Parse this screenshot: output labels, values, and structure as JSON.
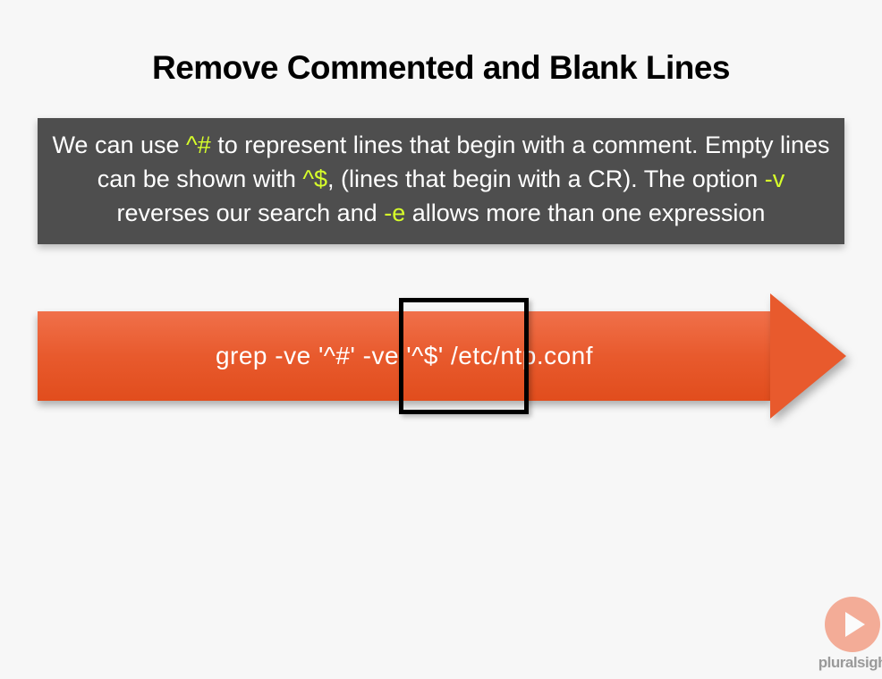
{
  "title": "Remove Commented and Blank Lines",
  "description": {
    "part1": "We can use ",
    "hl1": "^#",
    "part2": " to represent lines that begin with a comment. Empty lines can be shown with ",
    "hl2": "^$",
    "part3": ", (lines that begin with a CR). The option ",
    "hl3": "-v",
    "part4": " reverses our search and ",
    "hl4": "-e",
    "part5": " allows more than one expression"
  },
  "command": "grep -ve '^#' -ve '^$' /etc/ntp.conf",
  "brand": "pluralsigh"
}
